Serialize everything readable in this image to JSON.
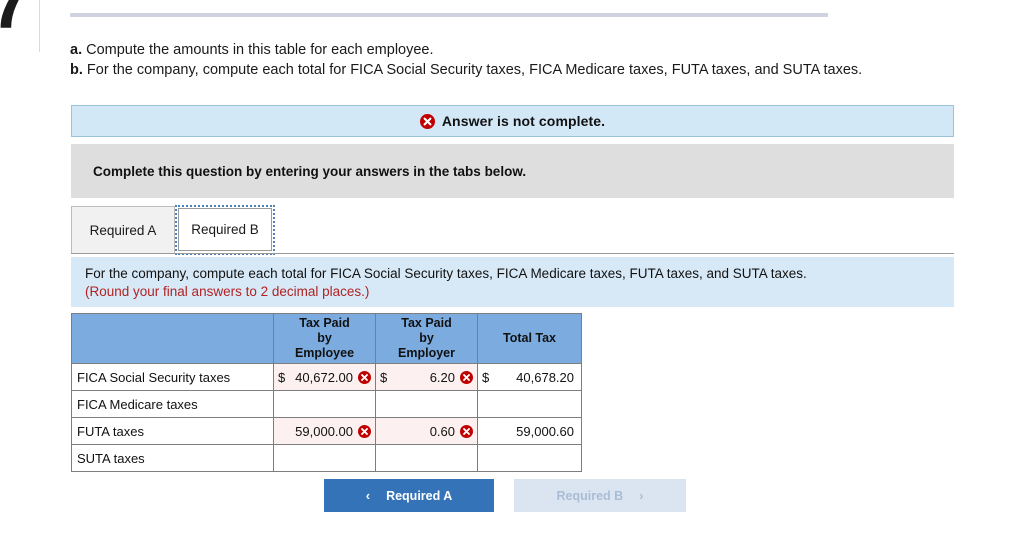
{
  "question_number": "7",
  "prompt": {
    "line_a_marker": "a.",
    "line_a": " Compute the amounts in this table for each employee.",
    "line_b_marker": "b.",
    "line_b": " For the company, compute each total for FICA Social Security taxes, FICA Medicare taxes, FUTA taxes, and SUTA taxes."
  },
  "alert": {
    "icon": "error-x-icon",
    "text": "Answer is not complete."
  },
  "gray_bar": {
    "text": "Complete this question by entering your answers in the tabs below."
  },
  "tabs": {
    "items": [
      {
        "label": "Required A",
        "active": false
      },
      {
        "label": "Required B",
        "active": true
      }
    ]
  },
  "blue_panel": {
    "line1": "For the company, compute each total for FICA Social Security taxes, FICA Medicare taxes, FUTA taxes, and SUTA taxes.",
    "line2": "(Round your final answers to 2 decimal places.)"
  },
  "table": {
    "headers": {
      "col0": "",
      "col1": "Tax Paid\nby\nEmployee",
      "col1_l1": "Tax Paid",
      "col1_l2": "by",
      "col1_l3": "Employee",
      "col2_l1": "Tax Paid",
      "col2_l2": "by",
      "col2_l3": "Employer",
      "col3": "Total Tax"
    },
    "rows": [
      {
        "label": "FICA Social Security taxes",
        "employee": {
          "dollar": "$",
          "value": "40,672.00",
          "wrong": true
        },
        "employer": {
          "dollar": "$",
          "value": "6.20",
          "wrong": true
        },
        "total": {
          "dollar": "$",
          "value": "40,678.20",
          "wrong": false
        }
      },
      {
        "label": "FICA Medicare taxes",
        "employee": {
          "dollar": "",
          "value": "",
          "wrong": false
        },
        "employer": {
          "dollar": "",
          "value": "",
          "wrong": false
        },
        "total": {
          "dollar": "",
          "value": "",
          "wrong": false
        }
      },
      {
        "label": "FUTA taxes",
        "employee": {
          "dollar": "",
          "value": "59,000.00",
          "wrong": true
        },
        "employer": {
          "dollar": "",
          "value": "0.60",
          "wrong": true
        },
        "total": {
          "dollar": "",
          "value": "59,000.60",
          "wrong": false
        }
      },
      {
        "label": "SUTA taxes",
        "employee": {
          "dollar": "",
          "value": "",
          "wrong": false
        },
        "employer": {
          "dollar": "",
          "value": "",
          "wrong": false
        },
        "total": {
          "dollar": "",
          "value": "",
          "wrong": false
        }
      }
    ]
  },
  "nav": {
    "prev_label": "Required A",
    "prev_chevron": "‹",
    "next_label": "Required B",
    "next_chevron": "›"
  },
  "colors": {
    "alert_bg": "#d3e8f7",
    "gray_bar_bg": "#dedede",
    "blue_panel_bg": "#d7e9f7",
    "table_header_bg": "#7cacdf",
    "error_red": "#c00000",
    "note_red": "#b22222",
    "wrong_cell_bg": "#fcf0f0",
    "btn_primary": "#3573b9",
    "btn_disabled": "#dbe5f1"
  }
}
